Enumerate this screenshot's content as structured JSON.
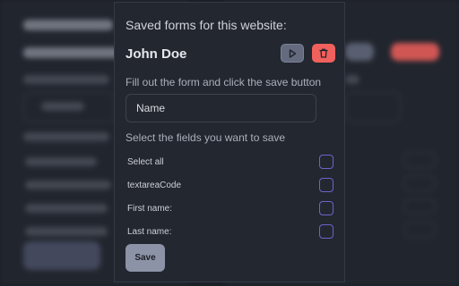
{
  "popup": {
    "title": "Saved forms for this website:",
    "profile": {
      "name": "John Doe",
      "play_icon": "play-icon",
      "delete_icon": "trash-icon"
    },
    "instruction": "Fill out the form and click the save button",
    "name_input": {
      "placeholder": "Name",
      "value": ""
    },
    "fields_label": "Select the fields you want to save",
    "fields": [
      {
        "label": "Select all",
        "checked": false
      },
      {
        "label": "textareaCode",
        "checked": false
      },
      {
        "label": "First name:",
        "checked": false
      },
      {
        "label": "Last name:",
        "checked": false
      }
    ],
    "save_label": "Save"
  },
  "colors": {
    "background": "#232730",
    "delete_button": "#f0605d",
    "play_button": "#646b7e",
    "checkbox_border": "#6c64c9",
    "save_button": "#8d93a6"
  }
}
